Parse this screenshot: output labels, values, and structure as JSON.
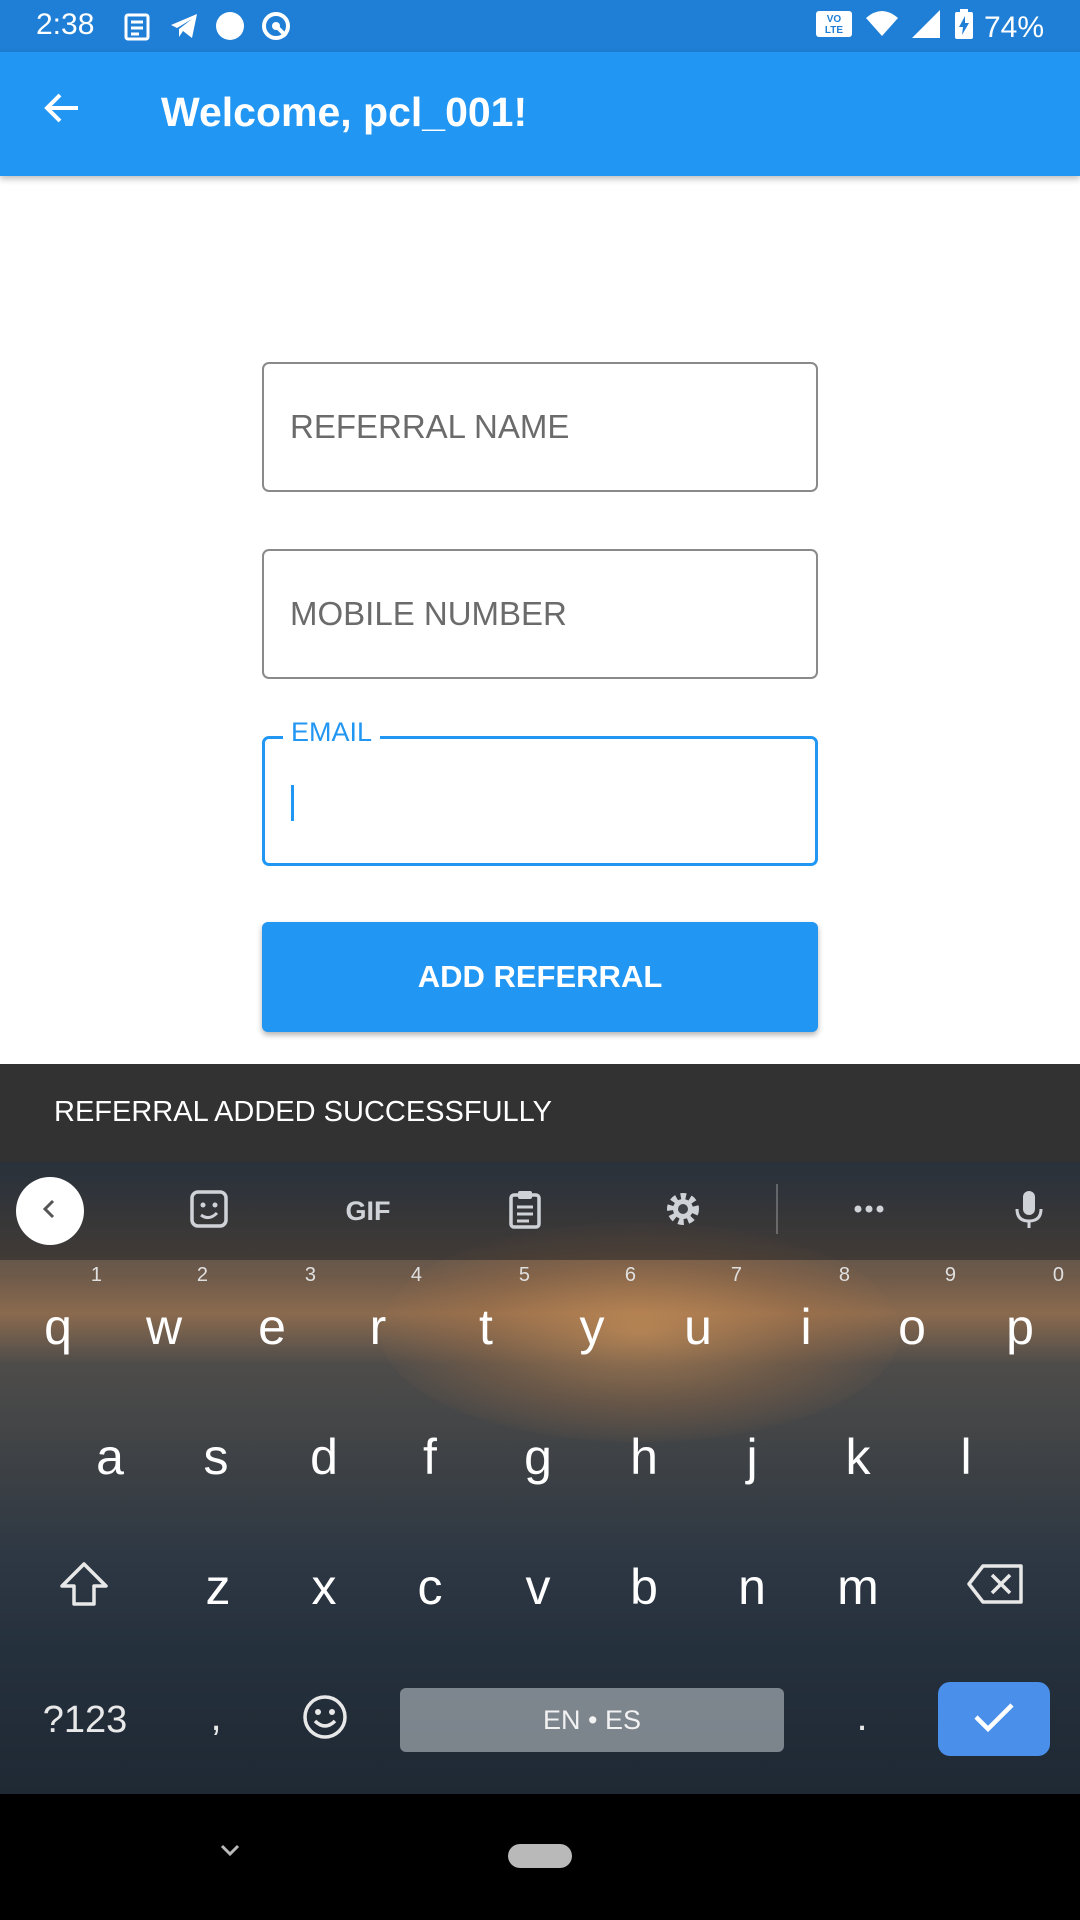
{
  "status_bar": {
    "time": "2:38",
    "battery": "74%",
    "left_icons": [
      "news-icon",
      "telegram-icon",
      "circle-icon",
      "sync-icon"
    ],
    "right_icons": [
      "volte-icon",
      "wifi-icon",
      "signal-icon",
      "battery-charging-icon"
    ],
    "volte_label": "VO LTE"
  },
  "app_bar": {
    "title": "Welcome, pcl_001!",
    "back_icon": "arrow-left-icon",
    "color": "#2196f3"
  },
  "form": {
    "referral_name": {
      "placeholder": "REFERRAL NAME",
      "value": ""
    },
    "mobile_number": {
      "placeholder": "MOBILE NUMBER",
      "value": ""
    },
    "email": {
      "label": "EMAIL",
      "value": ""
    },
    "submit_label": "ADD REFERRAL"
  },
  "snackbar": {
    "message": "REFERRAL ADDED SUCCESSFULLY"
  },
  "keyboard": {
    "toolbar": {
      "collapse_icon": "chevron-left-icon",
      "sticker_icon": "sticker-icon",
      "gif_label": "GIF",
      "clipboard_icon": "clipboard-icon",
      "settings_icon": "gear-icon",
      "more_icon": "more-horizontal-icon",
      "mic_icon": "microphone-icon"
    },
    "row1": [
      {
        "key": "q",
        "hint": "1"
      },
      {
        "key": "w",
        "hint": "2"
      },
      {
        "key": "e",
        "hint": "3"
      },
      {
        "key": "r",
        "hint": "4"
      },
      {
        "key": "t",
        "hint": "5"
      },
      {
        "key": "y",
        "hint": "6"
      },
      {
        "key": "u",
        "hint": "7"
      },
      {
        "key": "i",
        "hint": "8"
      },
      {
        "key": "o",
        "hint": "9"
      },
      {
        "key": "p",
        "hint": "0"
      }
    ],
    "row2": [
      "a",
      "s",
      "d",
      "f",
      "g",
      "h",
      "j",
      "k",
      "l"
    ],
    "row3": [
      "z",
      "x",
      "c",
      "v",
      "b",
      "n",
      "m"
    ],
    "symbols_label": "?123",
    "comma": ",",
    "period": ".",
    "space_label": "EN • ES",
    "enter_color": "#4a8fea"
  },
  "nav_bar": {
    "back_icon": "chevron-down-icon",
    "home_icon": "home-pill-icon"
  }
}
